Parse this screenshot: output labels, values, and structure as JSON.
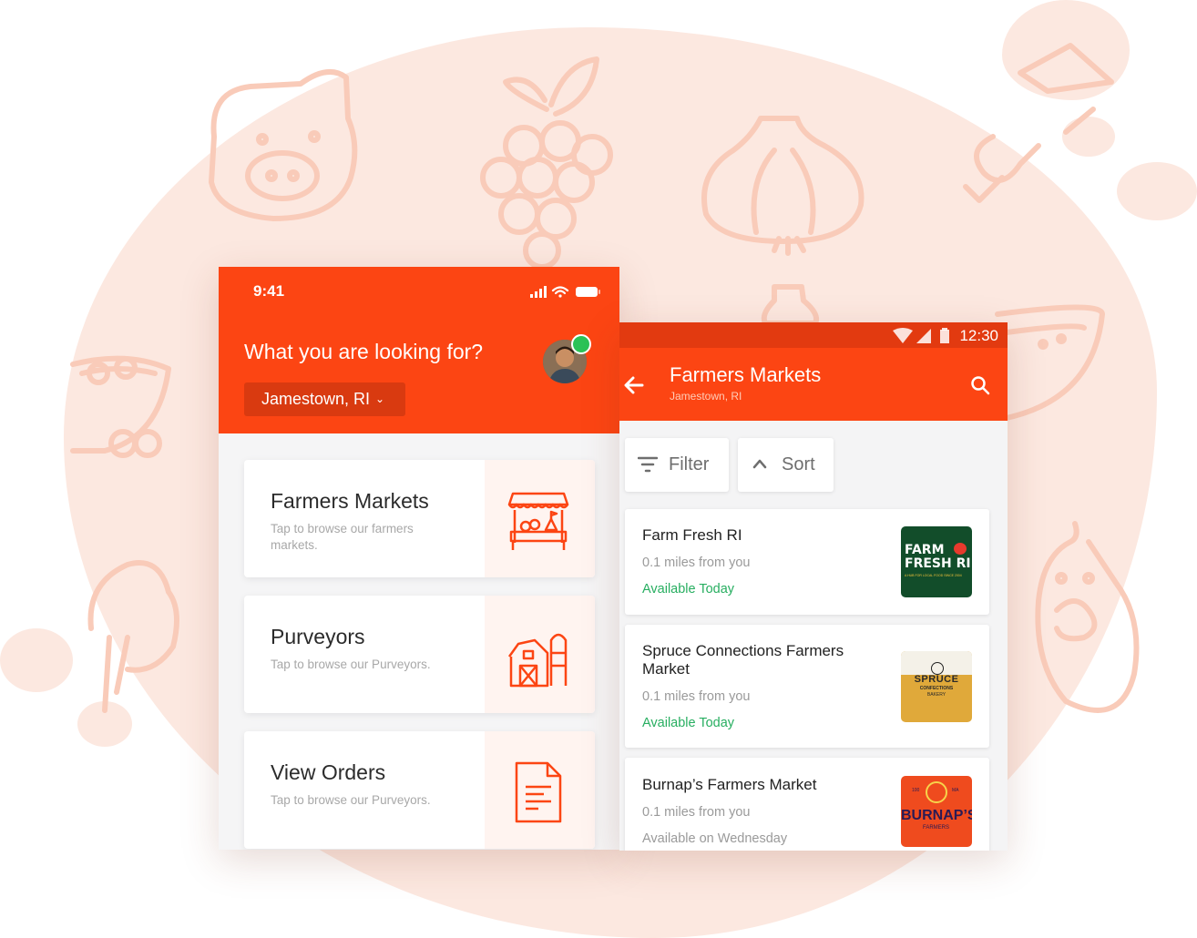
{
  "colors": {
    "accent": "#fc4513",
    "background_blob": "#fce8e0",
    "available": "#27ae60"
  },
  "ios_screen": {
    "time": "9:41",
    "header_title": "What you are looking for?",
    "location": "Jamestown, RI",
    "categories": [
      {
        "title": "Farmers Markets",
        "description": "Tap to browse our farmers markets.",
        "icon": "market-stall-icon"
      },
      {
        "title": "Purveyors",
        "description": "Tap to browse our Purveyors.",
        "icon": "barn-icon"
      },
      {
        "title": "View Orders",
        "description": "Tap to browse our Purveyors.",
        "icon": "document-icon"
      }
    ]
  },
  "android_screen": {
    "clock": "12:30",
    "title": "Farmers Markets",
    "subtitle": "Jamestown, RI",
    "filter_label": "Filter",
    "sort_label": "Sort",
    "markets": [
      {
        "name": "Farm Fresh RI",
        "distance": "0.1 miles from you",
        "availability": "Available Today",
        "logo": {
          "line1": "FARM",
          "line2": "FRESH RI",
          "tagline": "A HUB FOR LOCAL FOOD SINCE 2004"
        }
      },
      {
        "name": "Spruce Connections Farmers Market",
        "distance": "0.1 miles from you",
        "availability": "Available Today",
        "logo": {
          "line1": "SPRUCE",
          "line2": "CONFECTIONS",
          "line3": "BAKERY"
        }
      },
      {
        "name": "Burnap’s Farmers Market",
        "distance": "0.1 miles from you",
        "availability": "Available on Wednesday",
        "logo": {
          "line1": "BURNAP’S",
          "line2": "FARMERS",
          "top_left": "100",
          "top_right": "MA"
        }
      }
    ]
  }
}
